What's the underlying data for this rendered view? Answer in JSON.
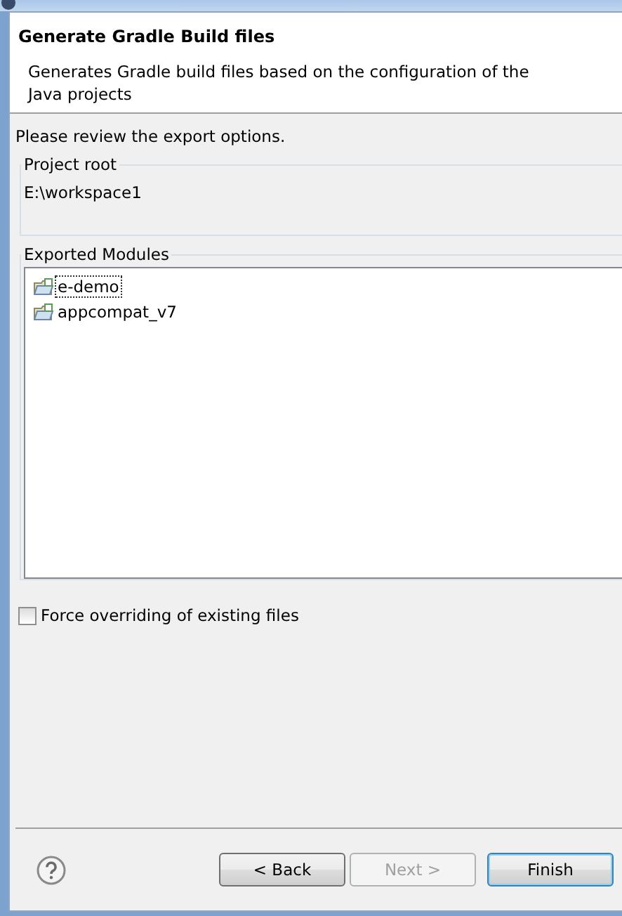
{
  "header": {
    "title": "Generate Gradle Build files",
    "description": "Generates Gradle build files based on the configuration of the Java projects"
  },
  "body": {
    "intro": "Please review the export options.",
    "project_root": {
      "label": "Project root",
      "value": "E:\\workspace1"
    },
    "exported_modules": {
      "label": "Exported Modules",
      "items": [
        {
          "name": "e-demo",
          "selected": true
        },
        {
          "name": "appcompat_v7",
          "selected": false
        }
      ]
    },
    "force_override": {
      "label": "Force overriding of existing files",
      "checked": false
    }
  },
  "buttons": [
    {
      "label": "< Back",
      "disabled": false,
      "default": false
    },
    {
      "label": "Next >",
      "disabled": true,
      "default": false
    },
    {
      "label": "Finish",
      "disabled": false,
      "default": true
    }
  ]
}
